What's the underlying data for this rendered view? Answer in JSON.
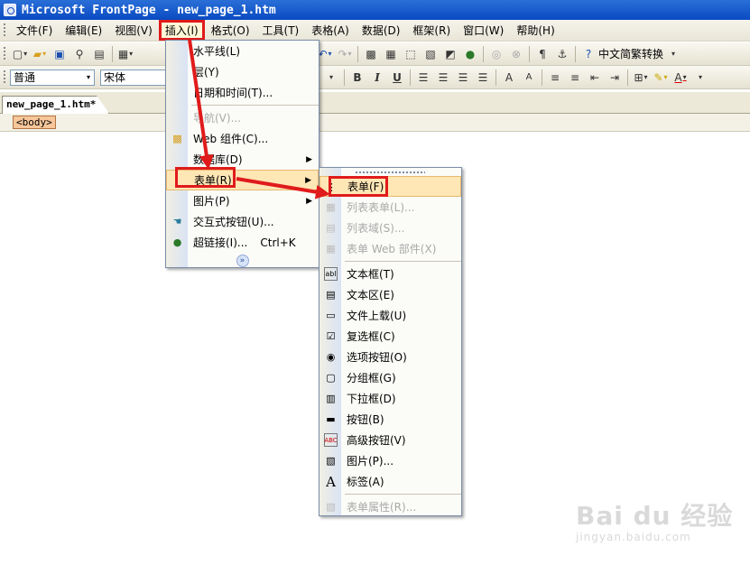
{
  "window": {
    "title": "Microsoft FrontPage - new_page_1.htm"
  },
  "menubar": {
    "items": [
      "文件(F)",
      "编辑(E)",
      "视图(V)",
      "插入(I)",
      "格式(O)",
      "工具(T)",
      "表格(A)",
      "数据(D)",
      "框架(R)",
      "窗口(W)",
      "帮助(H)"
    ],
    "active_index": 3
  },
  "toolbar": {
    "style_value": "普通",
    "font_value": "宋体",
    "chinese_convert_label": "中文简繁转换",
    "bold": "B",
    "italic": "I",
    "underline": "U"
  },
  "document": {
    "tab_label": "new_page_1.htm*",
    "tag_label": "<body>"
  },
  "insert_menu": {
    "items": [
      {
        "label": "水平线(L)",
        "disabled": false
      },
      {
        "label": "层(Y)",
        "disabled": false
      },
      {
        "label": "日期和时间(T)...",
        "disabled": false
      },
      {
        "label": "导航(V)...",
        "disabled": true
      },
      {
        "label": "Web 组件(C)...",
        "disabled": false
      },
      {
        "label": "数据库(D)",
        "disabled": false
      },
      {
        "label": "表单(R)",
        "disabled": false
      },
      {
        "label": "图片(P)",
        "disabled": false
      },
      {
        "label": "交互式按钮(U)...",
        "disabled": false
      },
      {
        "label": "超链接(I)...",
        "shortcut": "Ctrl+K",
        "disabled": false
      }
    ]
  },
  "form_submenu": {
    "items": [
      {
        "label": "表单(F)",
        "disabled": false
      },
      {
        "label": "列表表单(L)...",
        "disabled": true
      },
      {
        "label": "列表域(S)...",
        "disabled": true
      },
      {
        "label": "表单 Web 部件(X)",
        "disabled": true
      },
      {
        "label": "文本框(T)",
        "disabled": false
      },
      {
        "label": "文本区(E)",
        "disabled": false
      },
      {
        "label": "文件上载(U)",
        "disabled": false
      },
      {
        "label": "复选框(C)",
        "disabled": false
      },
      {
        "label": "选项按钮(O)",
        "disabled": false
      },
      {
        "label": "分组框(G)",
        "disabled": false
      },
      {
        "label": "下拉框(D)",
        "disabled": false
      },
      {
        "label": "按钮(B)",
        "disabled": false
      },
      {
        "label": "高级按钮(V)",
        "disabled": false
      },
      {
        "label": "图片(P)...",
        "disabled": false
      },
      {
        "label": "标签(A)",
        "disabled": false
      },
      {
        "label": "表单属性(R)...",
        "disabled": true
      }
    ]
  },
  "watermark": {
    "logo": "Bai du 经验",
    "url": "jingyan.baidu.com"
  },
  "colors": {
    "highlight": "#e01b1b",
    "menu_hover": "#ffe6b5",
    "titlebar": "#0a4ac2"
  }
}
